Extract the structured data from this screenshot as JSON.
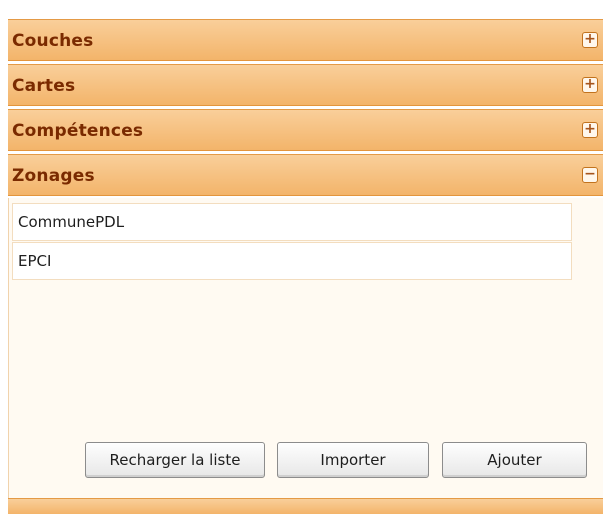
{
  "accordion": {
    "sections": [
      {
        "title": "Couches",
        "toggle": "+",
        "expanded": false
      },
      {
        "title": "Cartes",
        "toggle": "+",
        "expanded": false
      },
      {
        "title": "Compétences",
        "toggle": "+",
        "expanded": false
      },
      {
        "title": "Zonages",
        "toggle": "−",
        "expanded": true
      }
    ]
  },
  "zonages": {
    "items": [
      "CommunePDL",
      "EPCI"
    ],
    "buttons": {
      "reload": "Recharger la liste",
      "import": "Importer",
      "add": "Ajouter"
    }
  },
  "colors": {
    "header_bg": "#f5bd7c",
    "header_text": "#7a2a00",
    "body_bg": "#fffaf2"
  }
}
